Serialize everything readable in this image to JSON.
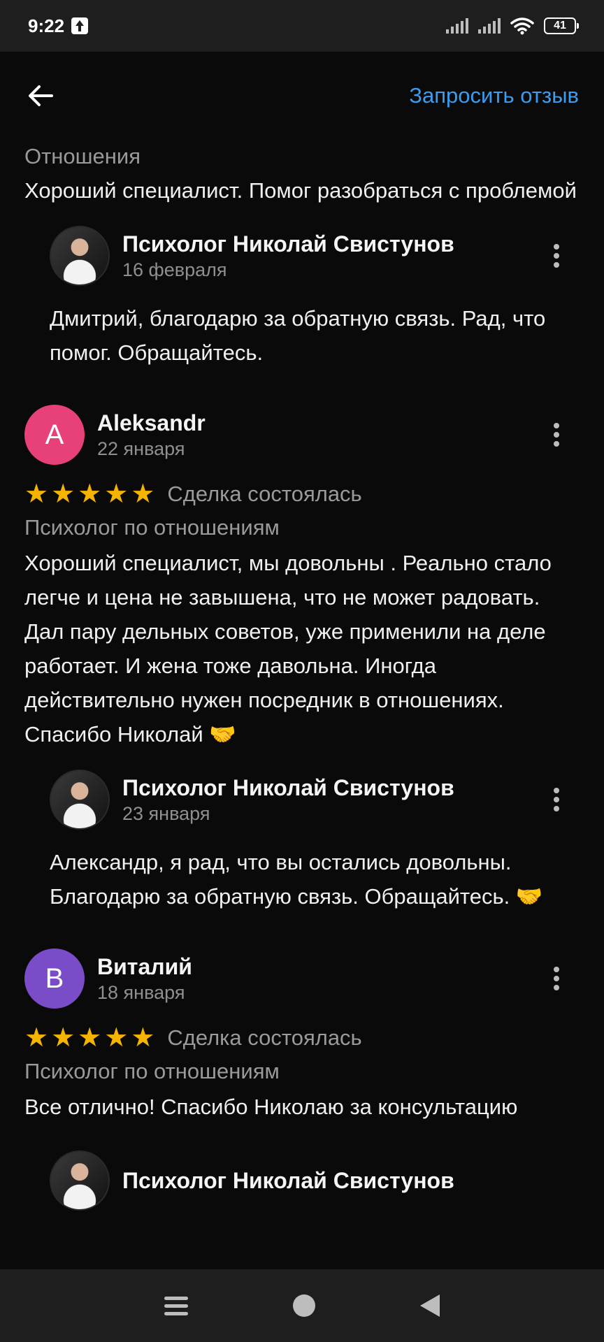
{
  "status_bar": {
    "time": "9:22",
    "battery": "41"
  },
  "header": {
    "request_review_label": "Запросить отзыв"
  },
  "review_1": {
    "category": "Отношения",
    "text": "Хороший специалист. Помог разобраться с проблемой",
    "reply": {
      "author": "Психолог Николай Свистунов",
      "date": "16 февраля",
      "text": "Дмитрий, благодарю за обратную связь. Рад, что помог. Обращайтесь."
    }
  },
  "review_2": {
    "author": "Aleksandr",
    "initial": "A",
    "avatar_color": "#e8417a",
    "date": "22 января",
    "rating": 5,
    "deal_status": "Сделка состоялась",
    "category": "Психолог по отношениям",
    "text": "Хороший специалист, мы довольны . Реально стало легче и цена не завышена, что не может радовать. Дал пару дельных советов, уже применили на деле работает. И жена тоже давольна. Иногда действительно нужен посредник в отношениях. Спасибо Николай 🤝",
    "reply": {
      "author": "Психолог Николай Свистунов",
      "date": "23 января",
      "text": "Александр,  я  рад, что вы остались довольны. Благодарю за обратную связь. Обращайтесь. 🤝"
    }
  },
  "review_3": {
    "author": "Виталий",
    "initial": "В",
    "avatar_color": "#7b4cc8",
    "date": "18 января",
    "rating": 5,
    "deal_status": "Сделка состоялась",
    "category": "Психолог по отношениям",
    "text": "Все отлично! Спасибо Николаю за консультацию",
    "reply": {
      "author": "Психолог Николай Свистунов"
    }
  },
  "stars": [
    "★",
    "★",
    "★",
    "★",
    "★"
  ]
}
